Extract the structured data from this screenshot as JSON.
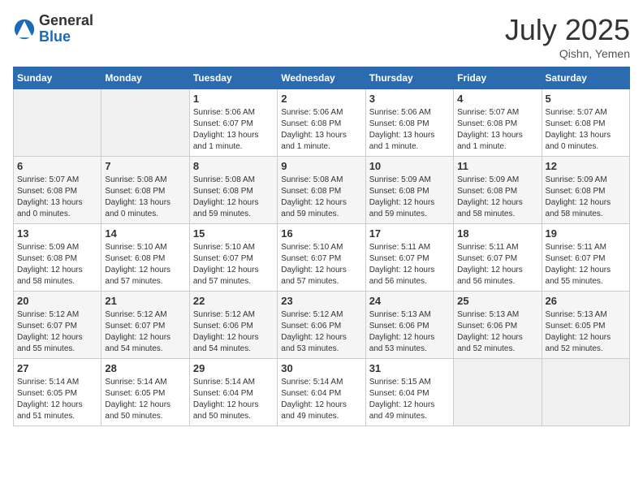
{
  "header": {
    "logo_general": "General",
    "logo_blue": "Blue",
    "month_year": "July 2025",
    "location": "Qishn, Yemen"
  },
  "calendar": {
    "days_of_week": [
      "Sunday",
      "Monday",
      "Tuesday",
      "Wednesday",
      "Thursday",
      "Friday",
      "Saturday"
    ],
    "weeks": [
      [
        {
          "day": null
        },
        {
          "day": null
        },
        {
          "day": 1,
          "sunrise": "Sunrise: 5:06 AM",
          "sunset": "Sunset: 6:07 PM",
          "daylight": "Daylight: 13 hours and 1 minute."
        },
        {
          "day": 2,
          "sunrise": "Sunrise: 5:06 AM",
          "sunset": "Sunset: 6:08 PM",
          "daylight": "Daylight: 13 hours and 1 minute."
        },
        {
          "day": 3,
          "sunrise": "Sunrise: 5:06 AM",
          "sunset": "Sunset: 6:08 PM",
          "daylight": "Daylight: 13 hours and 1 minute."
        },
        {
          "day": 4,
          "sunrise": "Sunrise: 5:07 AM",
          "sunset": "Sunset: 6:08 PM",
          "daylight": "Daylight: 13 hours and 1 minute."
        },
        {
          "day": 5,
          "sunrise": "Sunrise: 5:07 AM",
          "sunset": "Sunset: 6:08 PM",
          "daylight": "Daylight: 13 hours and 0 minutes."
        }
      ],
      [
        {
          "day": 6,
          "sunrise": "Sunrise: 5:07 AM",
          "sunset": "Sunset: 6:08 PM",
          "daylight": "Daylight: 13 hours and 0 minutes."
        },
        {
          "day": 7,
          "sunrise": "Sunrise: 5:08 AM",
          "sunset": "Sunset: 6:08 PM",
          "daylight": "Daylight: 13 hours and 0 minutes."
        },
        {
          "day": 8,
          "sunrise": "Sunrise: 5:08 AM",
          "sunset": "Sunset: 6:08 PM",
          "daylight": "Daylight: 12 hours and 59 minutes."
        },
        {
          "day": 9,
          "sunrise": "Sunrise: 5:08 AM",
          "sunset": "Sunset: 6:08 PM",
          "daylight": "Daylight: 12 hours and 59 minutes."
        },
        {
          "day": 10,
          "sunrise": "Sunrise: 5:09 AM",
          "sunset": "Sunset: 6:08 PM",
          "daylight": "Daylight: 12 hours and 59 minutes."
        },
        {
          "day": 11,
          "sunrise": "Sunrise: 5:09 AM",
          "sunset": "Sunset: 6:08 PM",
          "daylight": "Daylight: 12 hours and 58 minutes."
        },
        {
          "day": 12,
          "sunrise": "Sunrise: 5:09 AM",
          "sunset": "Sunset: 6:08 PM",
          "daylight": "Daylight: 12 hours and 58 minutes."
        }
      ],
      [
        {
          "day": 13,
          "sunrise": "Sunrise: 5:09 AM",
          "sunset": "Sunset: 6:08 PM",
          "daylight": "Daylight: 12 hours and 58 minutes."
        },
        {
          "day": 14,
          "sunrise": "Sunrise: 5:10 AM",
          "sunset": "Sunset: 6:08 PM",
          "daylight": "Daylight: 12 hours and 57 minutes."
        },
        {
          "day": 15,
          "sunrise": "Sunrise: 5:10 AM",
          "sunset": "Sunset: 6:07 PM",
          "daylight": "Daylight: 12 hours and 57 minutes."
        },
        {
          "day": 16,
          "sunrise": "Sunrise: 5:10 AM",
          "sunset": "Sunset: 6:07 PM",
          "daylight": "Daylight: 12 hours and 57 minutes."
        },
        {
          "day": 17,
          "sunrise": "Sunrise: 5:11 AM",
          "sunset": "Sunset: 6:07 PM",
          "daylight": "Daylight: 12 hours and 56 minutes."
        },
        {
          "day": 18,
          "sunrise": "Sunrise: 5:11 AM",
          "sunset": "Sunset: 6:07 PM",
          "daylight": "Daylight: 12 hours and 56 minutes."
        },
        {
          "day": 19,
          "sunrise": "Sunrise: 5:11 AM",
          "sunset": "Sunset: 6:07 PM",
          "daylight": "Daylight: 12 hours and 55 minutes."
        }
      ],
      [
        {
          "day": 20,
          "sunrise": "Sunrise: 5:12 AM",
          "sunset": "Sunset: 6:07 PM",
          "daylight": "Daylight: 12 hours and 55 minutes."
        },
        {
          "day": 21,
          "sunrise": "Sunrise: 5:12 AM",
          "sunset": "Sunset: 6:07 PM",
          "daylight": "Daylight: 12 hours and 54 minutes."
        },
        {
          "day": 22,
          "sunrise": "Sunrise: 5:12 AM",
          "sunset": "Sunset: 6:06 PM",
          "daylight": "Daylight: 12 hours and 54 minutes."
        },
        {
          "day": 23,
          "sunrise": "Sunrise: 5:12 AM",
          "sunset": "Sunset: 6:06 PM",
          "daylight": "Daylight: 12 hours and 53 minutes."
        },
        {
          "day": 24,
          "sunrise": "Sunrise: 5:13 AM",
          "sunset": "Sunset: 6:06 PM",
          "daylight": "Daylight: 12 hours and 53 minutes."
        },
        {
          "day": 25,
          "sunrise": "Sunrise: 5:13 AM",
          "sunset": "Sunset: 6:06 PM",
          "daylight": "Daylight: 12 hours and 52 minutes."
        },
        {
          "day": 26,
          "sunrise": "Sunrise: 5:13 AM",
          "sunset": "Sunset: 6:05 PM",
          "daylight": "Daylight: 12 hours and 52 minutes."
        }
      ],
      [
        {
          "day": 27,
          "sunrise": "Sunrise: 5:14 AM",
          "sunset": "Sunset: 6:05 PM",
          "daylight": "Daylight: 12 hours and 51 minutes."
        },
        {
          "day": 28,
          "sunrise": "Sunrise: 5:14 AM",
          "sunset": "Sunset: 6:05 PM",
          "daylight": "Daylight: 12 hours and 50 minutes."
        },
        {
          "day": 29,
          "sunrise": "Sunrise: 5:14 AM",
          "sunset": "Sunset: 6:04 PM",
          "daylight": "Daylight: 12 hours and 50 minutes."
        },
        {
          "day": 30,
          "sunrise": "Sunrise: 5:14 AM",
          "sunset": "Sunset: 6:04 PM",
          "daylight": "Daylight: 12 hours and 49 minutes."
        },
        {
          "day": 31,
          "sunrise": "Sunrise: 5:15 AM",
          "sunset": "Sunset: 6:04 PM",
          "daylight": "Daylight: 12 hours and 49 minutes."
        },
        {
          "day": null
        },
        {
          "day": null
        }
      ]
    ]
  }
}
